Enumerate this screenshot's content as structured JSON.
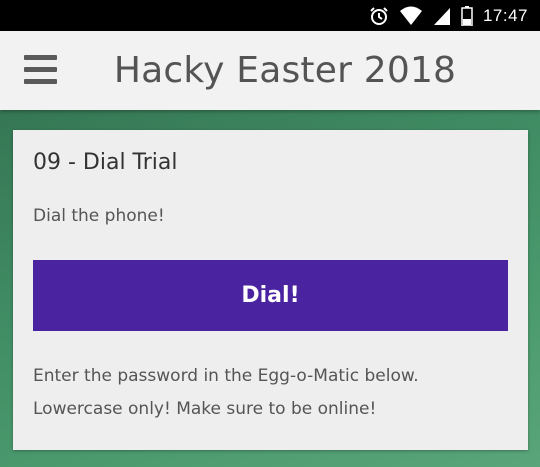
{
  "status_bar": {
    "time": "17:47",
    "icons": [
      "alarm-icon",
      "wifi-icon",
      "cell-signal-icon",
      "battery-icon"
    ]
  },
  "app_bar": {
    "title": "Hacky Easter 2018",
    "menu_icon": "hamburger-menu-icon"
  },
  "card": {
    "title": "09 - Dial Trial",
    "subtitle": "Dial the phone!",
    "button_label": "Dial!",
    "note": "Enter the password in the Egg-o-Matic below. Lowercase only! Make sure to be online!"
  },
  "colors": {
    "button": "#4a23a0",
    "app_bar": "#f2f2f2",
    "card": "#eeeeee",
    "background": "#3f8a62"
  }
}
